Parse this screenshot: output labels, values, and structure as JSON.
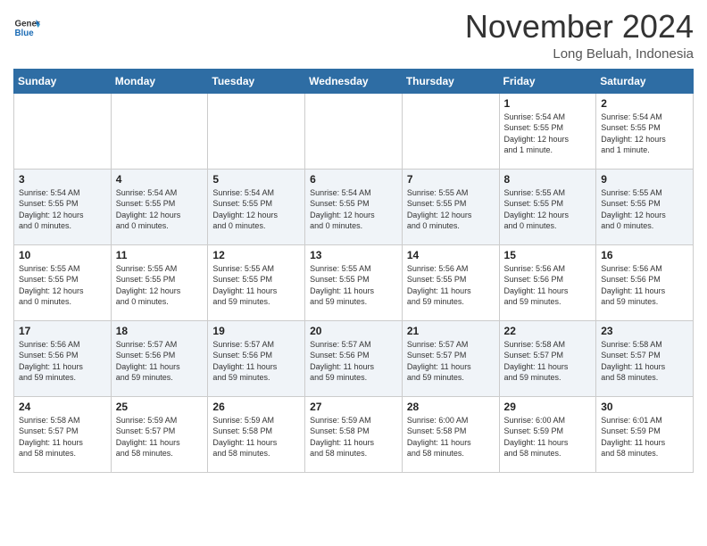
{
  "header": {
    "logo_line1": "General",
    "logo_line2": "Blue",
    "month": "November 2024",
    "location": "Long Beluah, Indonesia"
  },
  "weekdays": [
    "Sunday",
    "Monday",
    "Tuesday",
    "Wednesday",
    "Thursday",
    "Friday",
    "Saturday"
  ],
  "weeks": [
    [
      {
        "day": "",
        "info": ""
      },
      {
        "day": "",
        "info": ""
      },
      {
        "day": "",
        "info": ""
      },
      {
        "day": "",
        "info": ""
      },
      {
        "day": "",
        "info": ""
      },
      {
        "day": "1",
        "info": "Sunrise: 5:54 AM\nSunset: 5:55 PM\nDaylight: 12 hours\nand 1 minute."
      },
      {
        "day": "2",
        "info": "Sunrise: 5:54 AM\nSunset: 5:55 PM\nDaylight: 12 hours\nand 1 minute."
      }
    ],
    [
      {
        "day": "3",
        "info": "Sunrise: 5:54 AM\nSunset: 5:55 PM\nDaylight: 12 hours\nand 0 minutes."
      },
      {
        "day": "4",
        "info": "Sunrise: 5:54 AM\nSunset: 5:55 PM\nDaylight: 12 hours\nand 0 minutes."
      },
      {
        "day": "5",
        "info": "Sunrise: 5:54 AM\nSunset: 5:55 PM\nDaylight: 12 hours\nand 0 minutes."
      },
      {
        "day": "6",
        "info": "Sunrise: 5:54 AM\nSunset: 5:55 PM\nDaylight: 12 hours\nand 0 minutes."
      },
      {
        "day": "7",
        "info": "Sunrise: 5:55 AM\nSunset: 5:55 PM\nDaylight: 12 hours\nand 0 minutes."
      },
      {
        "day": "8",
        "info": "Sunrise: 5:55 AM\nSunset: 5:55 PM\nDaylight: 12 hours\nand 0 minutes."
      },
      {
        "day": "9",
        "info": "Sunrise: 5:55 AM\nSunset: 5:55 PM\nDaylight: 12 hours\nand 0 minutes."
      }
    ],
    [
      {
        "day": "10",
        "info": "Sunrise: 5:55 AM\nSunset: 5:55 PM\nDaylight: 12 hours\nand 0 minutes."
      },
      {
        "day": "11",
        "info": "Sunrise: 5:55 AM\nSunset: 5:55 PM\nDaylight: 12 hours\nand 0 minutes."
      },
      {
        "day": "12",
        "info": "Sunrise: 5:55 AM\nSunset: 5:55 PM\nDaylight: 11 hours\nand 59 minutes."
      },
      {
        "day": "13",
        "info": "Sunrise: 5:55 AM\nSunset: 5:55 PM\nDaylight: 11 hours\nand 59 minutes."
      },
      {
        "day": "14",
        "info": "Sunrise: 5:56 AM\nSunset: 5:55 PM\nDaylight: 11 hours\nand 59 minutes."
      },
      {
        "day": "15",
        "info": "Sunrise: 5:56 AM\nSunset: 5:56 PM\nDaylight: 11 hours\nand 59 minutes."
      },
      {
        "day": "16",
        "info": "Sunrise: 5:56 AM\nSunset: 5:56 PM\nDaylight: 11 hours\nand 59 minutes."
      }
    ],
    [
      {
        "day": "17",
        "info": "Sunrise: 5:56 AM\nSunset: 5:56 PM\nDaylight: 11 hours\nand 59 minutes."
      },
      {
        "day": "18",
        "info": "Sunrise: 5:57 AM\nSunset: 5:56 PM\nDaylight: 11 hours\nand 59 minutes."
      },
      {
        "day": "19",
        "info": "Sunrise: 5:57 AM\nSunset: 5:56 PM\nDaylight: 11 hours\nand 59 minutes."
      },
      {
        "day": "20",
        "info": "Sunrise: 5:57 AM\nSunset: 5:56 PM\nDaylight: 11 hours\nand 59 minutes."
      },
      {
        "day": "21",
        "info": "Sunrise: 5:57 AM\nSunset: 5:57 PM\nDaylight: 11 hours\nand 59 minutes."
      },
      {
        "day": "22",
        "info": "Sunrise: 5:58 AM\nSunset: 5:57 PM\nDaylight: 11 hours\nand 59 minutes."
      },
      {
        "day": "23",
        "info": "Sunrise: 5:58 AM\nSunset: 5:57 PM\nDaylight: 11 hours\nand 58 minutes."
      }
    ],
    [
      {
        "day": "24",
        "info": "Sunrise: 5:58 AM\nSunset: 5:57 PM\nDaylight: 11 hours\nand 58 minutes."
      },
      {
        "day": "25",
        "info": "Sunrise: 5:59 AM\nSunset: 5:57 PM\nDaylight: 11 hours\nand 58 minutes."
      },
      {
        "day": "26",
        "info": "Sunrise: 5:59 AM\nSunset: 5:58 PM\nDaylight: 11 hours\nand 58 minutes."
      },
      {
        "day": "27",
        "info": "Sunrise: 5:59 AM\nSunset: 5:58 PM\nDaylight: 11 hours\nand 58 minutes."
      },
      {
        "day": "28",
        "info": "Sunrise: 6:00 AM\nSunset: 5:58 PM\nDaylight: 11 hours\nand 58 minutes."
      },
      {
        "day": "29",
        "info": "Sunrise: 6:00 AM\nSunset: 5:59 PM\nDaylight: 11 hours\nand 58 minutes."
      },
      {
        "day": "30",
        "info": "Sunrise: 6:01 AM\nSunset: 5:59 PM\nDaylight: 11 hours\nand 58 minutes."
      }
    ]
  ]
}
